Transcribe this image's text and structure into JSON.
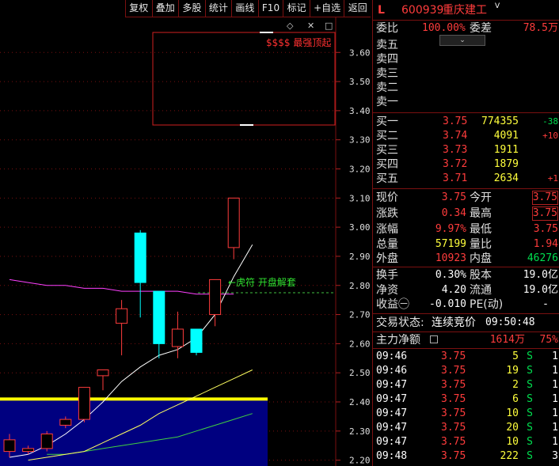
{
  "toolbar": [
    "复权",
    "叠加",
    "多股",
    "统计",
    "画线",
    "F10",
    "标记",
    "+自选",
    "返回"
  ],
  "chart": {
    "price_axis": [
      "3.60",
      "3.50",
      "3.40",
      "3.30",
      "3.20",
      "3.10",
      "3.00",
      "2.90",
      "2.80",
      "2.70",
      "2.60",
      "2.50",
      "2.40",
      "2.30",
      "2.20"
    ],
    "annotation_box_text": "$$$$ 最强顶起",
    "arrow_label": "←虎符 开盘解套",
    "colors": {
      "up": "#ff3c3c",
      "down": "#00ffff",
      "ma5": "#ffffff",
      "ma10": "#ffff60",
      "ma20": "#40d040",
      "ma60": "#ff40ff",
      "volume_fill": "#000080"
    }
  },
  "chart_data": {
    "type": "candlestick",
    "ylim": [
      2.18,
      3.78
    ],
    "candles": [
      {
        "open": 2.23,
        "close": 2.27,
        "high": 2.29,
        "low": 2.21
      },
      {
        "open": 2.23,
        "close": 2.24,
        "high": 2.25,
        "low": 2.22
      },
      {
        "open": 2.24,
        "close": 2.29,
        "high": 2.3,
        "low": 2.23
      },
      {
        "open": 2.32,
        "close": 2.34,
        "high": 2.35,
        "low": 2.31
      },
      {
        "open": 2.34,
        "close": 2.45,
        "high": 2.45,
        "low": 2.33
      },
      {
        "open": 2.49,
        "close": 2.51,
        "high": 2.51,
        "low": 2.44
      },
      {
        "open": 2.67,
        "close": 2.72,
        "high": 2.75,
        "low": 2.56
      },
      {
        "open": 2.98,
        "close": 2.81,
        "high": 2.99,
        "low": 2.69
      },
      {
        "open": 2.78,
        "close": 2.6,
        "high": 2.78,
        "low": 2.55
      },
      {
        "open": 2.59,
        "close": 2.65,
        "high": 2.71,
        "low": 2.55
      },
      {
        "open": 2.65,
        "close": 2.57,
        "high": 2.65,
        "low": 2.56
      },
      {
        "open": 2.7,
        "close": 2.82,
        "high": 2.82,
        "low": 2.66
      },
      {
        "open": 2.93,
        "close": 3.1,
        "high": 3.1,
        "low": 2.89
      }
    ],
    "ma_white": [
      2.21,
      2.22,
      2.25,
      2.29,
      2.34,
      2.4,
      2.47,
      2.52,
      2.56,
      2.58,
      2.62,
      2.7,
      2.83,
      2.94
    ],
    "ma_yellow": [
      2.2,
      2.21,
      2.22,
      2.23,
      2.26,
      2.29,
      2.32,
      2.36,
      2.39,
      2.42,
      2.45,
      2.48,
      2.51
    ],
    "ma_green": [
      2.22,
      2.22,
      2.23,
      2.24,
      2.25,
      2.26,
      2.27,
      2.28,
      2.3,
      2.32,
      2.34,
      2.36
    ],
    "ma_magenta": [
      2.82,
      2.81,
      2.8,
      2.8,
      2.79,
      2.79,
      2.78,
      2.78,
      2.78,
      2.78,
      2.77,
      2.77,
      2.77
    ],
    "reference_line": 2.41,
    "dashed_line": 2.775
  },
  "quote": {
    "header": {
      "code_prefix": "L",
      "code": "600939",
      "name": "重庆建工",
      "flag": "V"
    },
    "weibi": {
      "label": "委比",
      "value": "100.00%",
      "label2": "委差",
      "value2": "78.5万"
    },
    "sells": [
      {
        "label": "卖五"
      },
      {
        "label": "卖四"
      },
      {
        "label": "卖三"
      },
      {
        "label": "卖二"
      },
      {
        "label": "卖一"
      }
    ],
    "buys": [
      {
        "label": "买一",
        "price": "3.75",
        "vol": "774355",
        "chg": "-38"
      },
      {
        "label": "买二",
        "price": "3.74",
        "vol": "4091",
        "chg": "+10"
      },
      {
        "label": "买三",
        "price": "3.73",
        "vol": "1911",
        "chg": ""
      },
      {
        "label": "买四",
        "price": "3.72",
        "vol": "1879",
        "chg": ""
      },
      {
        "label": "买五",
        "price": "3.71",
        "vol": "2634",
        "chg": "+1"
      }
    ],
    "stats": [
      {
        "l1": "现价",
        "v1": "3.75",
        "l2": "今开",
        "v2": "3.75"
      },
      {
        "l1": "涨跌",
        "v1": "0.34",
        "l2": "最高",
        "v2": "3.75"
      },
      {
        "l1": "涨幅",
        "v1": "9.97%",
        "l2": "最低",
        "v2": "3.75"
      },
      {
        "l1": "总量",
        "v1": "57199",
        "l2": "量比",
        "v2": "1.94"
      },
      {
        "l1": "外盘",
        "v1": "10923",
        "l2": "内盘",
        "v2": "46276"
      }
    ],
    "fund": [
      {
        "l1": "换手",
        "v1": "0.30%",
        "l2": "股本",
        "v2": "19.0亿"
      },
      {
        "l1": "净资",
        "v1": "4.20",
        "l2": "流通",
        "v2": "19.0亿"
      },
      {
        "l1": "收益㊀",
        "v1": "-0.010",
        "l2": "PE(动)",
        "v2": "-"
      }
    ],
    "trade_status": {
      "label": "交易状态:",
      "value": "连续竞价",
      "time": "09:50:48"
    },
    "main_flow": {
      "label": "主力净额",
      "value": "1614万",
      "pct": "75%"
    },
    "ticks": [
      {
        "time": "09:46",
        "price": "3.75",
        "vol": "5",
        "side": "S",
        "n": "1"
      },
      {
        "time": "09:46",
        "price": "3.75",
        "vol": "19",
        "side": "S",
        "n": "1"
      },
      {
        "time": "09:47",
        "price": "3.75",
        "vol": "2",
        "side": "S",
        "n": "1"
      },
      {
        "time": "09:47",
        "price": "3.75",
        "vol": "6",
        "side": "S",
        "n": "1"
      },
      {
        "time": "09:47",
        "price": "3.75",
        "vol": "10",
        "side": "S",
        "n": "1"
      },
      {
        "time": "09:47",
        "price": "3.75",
        "vol": "20",
        "side": "S",
        "n": "1"
      },
      {
        "time": "09:47",
        "price": "3.75",
        "vol": "10",
        "side": "S",
        "n": "1"
      },
      {
        "time": "09:48",
        "price": "3.75",
        "vol": "222",
        "side": "S",
        "n": "3"
      }
    ]
  }
}
